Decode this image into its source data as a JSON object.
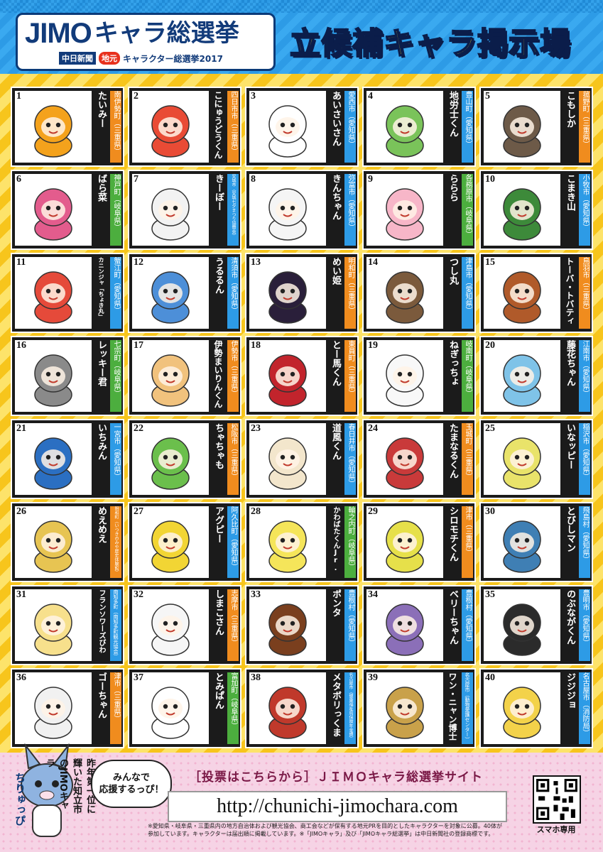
{
  "header": {
    "logo_jimo": "JIMO",
    "logo_rest": "キャラ総選挙",
    "logo_newspaper": "中日新聞",
    "logo_jimoto": "地元",
    "logo_sub": "キャラクター総選挙2017",
    "title": "立候補キャラ掲示場"
  },
  "candidates": [
    {
      "num": "1",
      "name": "たいみー",
      "loc": "南伊勢町（三重県）",
      "loc_color": "orange"
    },
    {
      "num": "2",
      "name": "こにゅうどうくん",
      "loc": "四日市市（三重県）",
      "loc_color": "orange"
    },
    {
      "num": "3",
      "name": "あいさいさん",
      "loc": "愛西市（愛知県）",
      "loc_color": "blue"
    },
    {
      "num": "4",
      "name": "地労士くん",
      "loc": "豊山町（愛知県）",
      "loc_color": "blue"
    },
    {
      "num": "5",
      "name": "こもしか",
      "loc": "菰野町（三重県）",
      "loc_color": "orange"
    },
    {
      "num": "6",
      "name": "ばら菜",
      "loc": "神戸町（岐阜県）",
      "loc_color": "green"
    },
    {
      "num": "7",
      "name": "きーぼー",
      "loc": "安城市（安城七夕まつり協賛会）",
      "loc_color": "blue"
    },
    {
      "num": "8",
      "name": "きんちゃん",
      "loc": "弥富市（愛知県）",
      "loc_color": "blue"
    },
    {
      "num": "9",
      "name": "ららら",
      "loc": "各務原市（岐阜県）",
      "loc_color": "green"
    },
    {
      "num": "10",
      "name": "こまき山",
      "loc": "小牧市（愛知県）",
      "loc_color": "blue"
    },
    {
      "num": "11",
      "name": "カニンジャ「ちょき丸」",
      "loc": "蟹江町（愛知県）",
      "loc_color": "blue"
    },
    {
      "num": "12",
      "name": "うるるん",
      "loc": "清須市（愛知県）",
      "loc_color": "blue"
    },
    {
      "num": "13",
      "name": "めい姫",
      "loc": "明和町（三重県）",
      "loc_color": "orange"
    },
    {
      "num": "14",
      "name": "つし丸",
      "loc": "津島市（愛知県）",
      "loc_color": "blue"
    },
    {
      "num": "15",
      "name": "トーバ・トバティ",
      "loc": "鳥羽市（三重県）",
      "loc_color": "orange"
    },
    {
      "num": "16",
      "name": "レッキー君",
      "loc": "七宗町（岐阜県）",
      "loc_color": "green"
    },
    {
      "num": "17",
      "name": "伊勢まいりんくん",
      "loc": "伊勢市（三重県）",
      "loc_color": "orange"
    },
    {
      "num": "18",
      "name": "とー馬くん",
      "loc": "東員町（三重県）",
      "loc_color": "orange"
    },
    {
      "num": "19",
      "name": "ねぎっちょ",
      "loc": "岐南町（岐阜県）",
      "loc_color": "green"
    },
    {
      "num": "20",
      "name": "藤花ちゃん",
      "loc": "江南市（愛知県）",
      "loc_color": "blue"
    },
    {
      "num": "21",
      "name": "いちみん",
      "loc": "一宮市（愛知県）",
      "loc_color": "blue"
    },
    {
      "num": "22",
      "name": "ちゃちゃも",
      "loc": "松阪市（三重県）",
      "loc_color": "orange"
    },
    {
      "num": "23",
      "name": "道風くん",
      "loc": "春日井市（愛知県）",
      "loc_color": "blue"
    },
    {
      "num": "24",
      "name": "たまなるくん",
      "loc": "玉城町（三重県）",
      "loc_color": "orange"
    },
    {
      "num": "25",
      "name": "いなッピー",
      "loc": "稲沢市（愛知県）",
      "loc_color": "blue"
    },
    {
      "num": "26",
      "name": "めえめえ",
      "loc": "明和町（いつきのみや歴史体験館）",
      "loc_color": "orange"
    },
    {
      "num": "27",
      "name": "アグピー",
      "loc": "阿久比町（愛知県）",
      "loc_color": "blue"
    },
    {
      "num": "28",
      "name": "かわばたくんJr.",
      "loc": "輪之内町（岐阜県）",
      "loc_color": "green"
    },
    {
      "num": "29",
      "name": "シロモチくん",
      "loc": "津市（三重県）",
      "loc_color": "orange"
    },
    {
      "num": "30",
      "name": "とびしマン",
      "loc": "飛島村（愛知県）",
      "loc_color": "blue"
    },
    {
      "num": "31",
      "name": "フランソワーズびわ",
      "loc": "南知多町（南知多町観光協会）",
      "loc_color": "blue"
    },
    {
      "num": "32",
      "name": "しまこさん",
      "loc": "志摩市（三重県）",
      "loc_color": "orange"
    },
    {
      "num": "33",
      "name": "ポンタ",
      "loc": "豊根村（愛知県）",
      "loc_color": "blue"
    },
    {
      "num": "34",
      "name": "ベリーちゃん",
      "loc": "豊根村（愛知県）",
      "loc_color": "blue"
    },
    {
      "num": "35",
      "name": "のぶながくん",
      "loc": "豊明市（愛知県）",
      "loc_color": "blue"
    },
    {
      "num": "36",
      "name": "ゴーちゃん",
      "loc": "津市（三重県）",
      "loc_color": "orange"
    },
    {
      "num": "37",
      "name": "とみぱん",
      "loc": "富加町（岐阜県）",
      "loc_color": "green"
    },
    {
      "num": "38",
      "name": "メタボリっくま",
      "loc": "名古屋市（健康福祉局保険年金課）",
      "loc_color": "blue"
    },
    {
      "num": "39",
      "name": "ワン・ニャン博士",
      "loc": "名古屋市（動物愛護センター）",
      "loc_color": "blue"
    },
    {
      "num": "40",
      "name": "ジジジョ",
      "loc": "名古屋市（消防局）",
      "loc_color": "blue"
    }
  ],
  "footer": {
    "corner_text": "昨年第一位に輝いた知立市のJIMOキャラ",
    "corner_name": "ちりゅっぴ",
    "bubble_line1": "みんなで",
    "bubble_line2": "応援するっぴ！",
    "vote_label": "［投票はこちらから］ＪＩＭＯキャラ総選挙サイト",
    "url": "http://chunichi-jimochara.com",
    "note": "※愛知県・岐阜県・三重県内の地方自治体および観光協会、商工会などが保有する地元PRを目的としたキャラクターを対象に公募。40体が参加しています。キャラクターは届出順に掲載しています。※「JIMOキャラ」及び「JIMOキャラ総選挙」は中日新聞社の登録商標です。",
    "qr_label": "スマホ専用"
  },
  "colors": {
    "loc_orange": "#f08c1e",
    "loc_blue": "#2d9be6",
    "loc_green": "#4cae3e",
    "header_blue": "#2d9be6",
    "title_yellow": "#ffe11a",
    "footer_pink": "#f6d3e5"
  }
}
